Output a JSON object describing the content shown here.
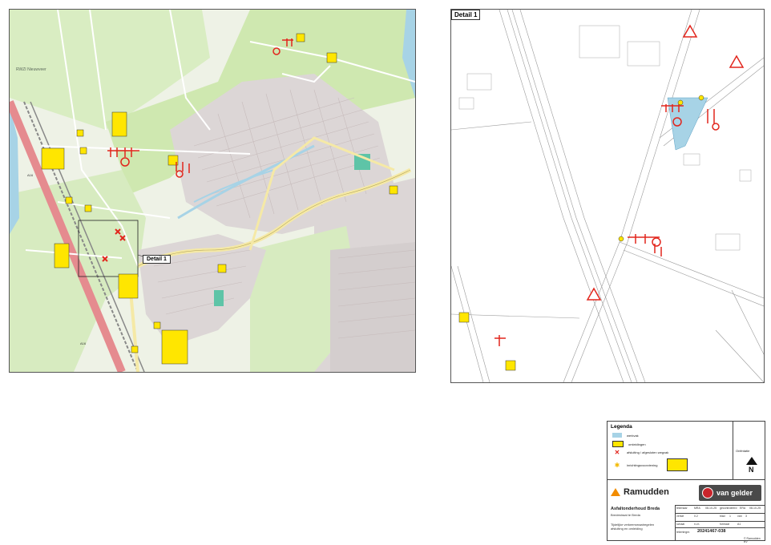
{
  "sheet": {
    "detail_label": "Detail 1",
    "detail_box_label": "Detail  1"
  },
  "map_labels": {
    "rwzi": "RWZI Nieuwveer",
    "a16_1": "A16",
    "a16_2": "A16",
    "rijks_label": "Rijksweg"
  },
  "legend": {
    "title": "Legenda",
    "items": [
      {
        "label": "werkvak"
      },
      {
        "label": "omleidingen"
      },
      {
        "label": "afsluiting / afgesloten wegvak"
      },
      {
        "label": "inrichtingsvoorziening"
      }
    ],
    "north_label": "Oriëntatie",
    "north_letter": "N"
  },
  "titleblock": {
    "company": "Ramudden",
    "partner": "van gelder",
    "project_title": "Asfaltonderhoud Breda",
    "project_sub": "Bredestraat te Breda",
    "desc_line1": "Tijdelijke verkeersmaatregelen",
    "desc_line2": "afsluiting en omleiding",
    "drawing_number": "20241467-038",
    "copyright": "© Ramudden BV",
    "meta": {
      "tekenaar_label": "tekenaar",
      "tekenaar": "MRA",
      "date1": "08-10-25",
      "gecontroleerd_label": "gecontroleerd",
      "gecontroleerd": "ERA",
      "date2": "08-10-25",
      "versie_label": "versie",
      "versie": "0.2",
      "blad_label": "blad",
      "blad": "1",
      "van_label": "van",
      "van": "3",
      "schaal_label": "schaal",
      "schaal": "n.v.t.",
      "formaat_label": "formaat",
      "formaat": "A1",
      "nummer_label": "tekeningnr."
    }
  },
  "colors": {
    "map_green": "#cfe8b0",
    "map_light": "#eef2e6",
    "residential": "#dcd6d6",
    "highway": "#e58b8f",
    "road_yellow": "#f5e9a6",
    "water": "#a7d3e6",
    "sign_yellow": "#ffe600",
    "sign_red": "#e2261d"
  }
}
